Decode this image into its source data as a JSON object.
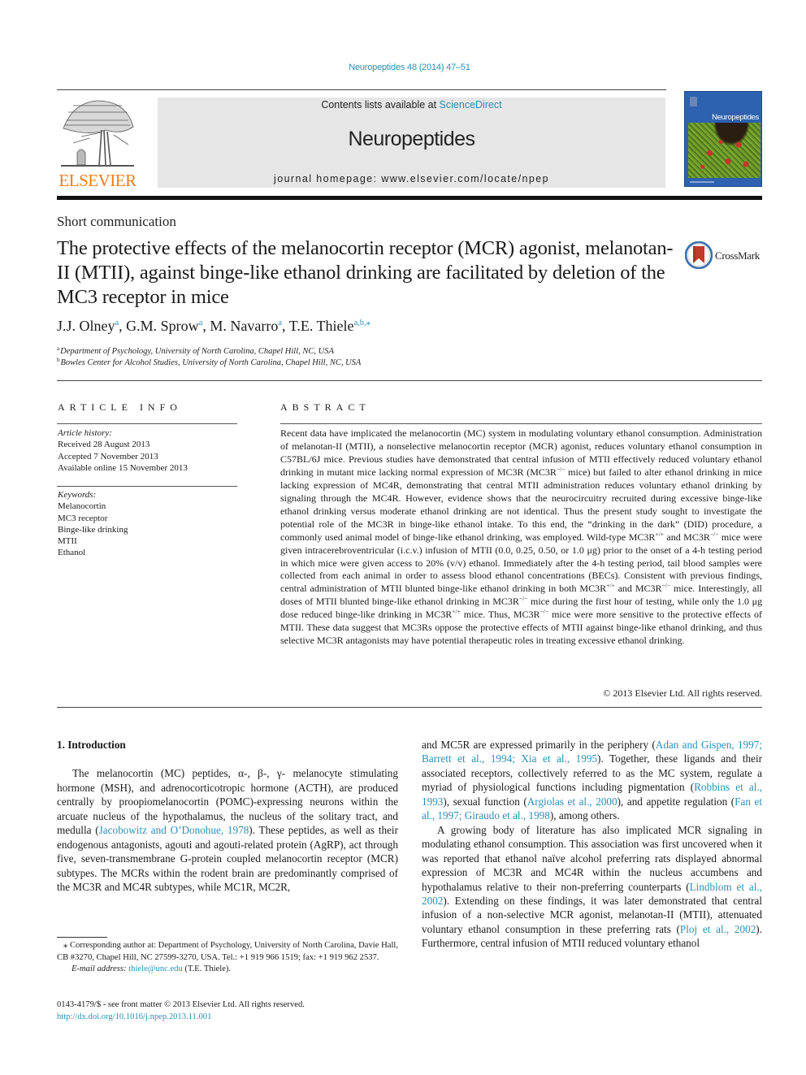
{
  "header": {
    "journal_reference": "Neuropeptides 48 (2014) 47–51",
    "publisher_name": "ELSEVIER",
    "contents_prefix": "Contents lists available at ",
    "contents_link": "ScienceDirect",
    "journal_name": "Neuropeptides",
    "homepage_prefix": "journal homepage: ",
    "homepage_url": "www.elsevier.com/locate/npep",
    "cover_title": "Neuropeptides",
    "publisher_color": "#f07d1b",
    "link_color": "#2a8fb8"
  },
  "article": {
    "type": "Short communication",
    "title": "The protective effects of the melanocortin receptor (MCR) agonist, melanotan-II (MTII), against binge-like ethanol drinking are facilitated by deletion of the MC3 receptor in mice",
    "crossmark_label": "CrossMark",
    "authors": [
      {
        "name": "J.J. Olney",
        "sup": "a"
      },
      {
        "name": "G.M. Sprow",
        "sup": "a"
      },
      {
        "name": "M. Navarro",
        "sup": "a"
      },
      {
        "name": "T.E. Thiele",
        "sup": "a,b,⁎"
      }
    ],
    "affiliations": [
      {
        "key": "a",
        "text": "Department of Psychology, University of North Carolina, Chapel Hill, NC, USA"
      },
      {
        "key": "b",
        "text": "Bowles Center for Alcohol Studies, University of North Carolina, Chapel Hill, NC, USA"
      }
    ]
  },
  "article_info": {
    "heading": "ARTICLE INFO",
    "history_label": "Article history:",
    "history": [
      "Received 28 August 2013",
      "Accepted 7 November 2013",
      "Available online 15 November 2013"
    ],
    "keywords_label": "Keywords:",
    "keywords": [
      "Melanocortin",
      "MC3 receptor",
      "Binge-like drinking",
      "MTII",
      "Ethanol"
    ]
  },
  "abstract": {
    "heading": "ABSTRACT",
    "segments": [
      "Recent data have implicated the melanocortin (MC) system in modulating voluntary ethanol consumption. Administration of melanotan-II (MTII), a nonselective melanocortin receptor (MCR) agonist, reduces voluntary ethanol consumption in C57BL/6J mice. Previous studies have demonstrated that central infusion of MTII effectively reduced voluntary ethanol drinking in mutant mice lacking normal expression of MC3R (MC3R",
      "−/−",
      " mice) but failed to alter ethanol drinking in mice lacking expression of MC4R, demonstrating that central MTII administration reduces voluntary ethanol drinking by signaling through the MC4R. However, evidence shows that the neurocircuitry recruited during excessive binge-like ethanol drinking versus moderate ethanol drinking are not identical. Thus the present study sought to investigate the potential role of the MC3R in binge-like ethanol intake. To this end, the “drinking in the dark” (DID) procedure, a commonly used animal model of binge-like ethanol drinking, was employed. Wild-type MC3R",
      "+/+",
      " and MC3R",
      "−/−",
      " mice were given intracerebroventricular (i.c.v.) infusion of MTII (0.0, 0.25, 0.50, or 1.0 μg) prior to the onset of a 4-h testing period in which mice were given access to 20% (v/v) ethanol. Immediately after the 4-h testing period, tail blood samples were collected from each animal in order to assess blood ethanol concentrations (BECs). Consistent with previous findings, central administration of MTII blunted binge-like ethanol drinking in both MC3R",
      "+/+",
      " and MC3R",
      "−/−",
      " mice. Interestingly, all doses of MTII blunted binge-like ethanol drinking in MC3R",
      "−/−",
      " mice during the first hour of testing, while only the 1.0 μg dose reduced binge-like drinking in MC3R",
      "+/+",
      " mice. Thus, MC3R",
      "−/−",
      " mice were more sensitive to the protective effects of MTII. These data suggest that MC3Rs oppose the protective effects of MTII against binge-like ethanol drinking, and thus selective MC3R antagonists may have potential therapeutic roles in treating excessive ethanol drinking."
    ],
    "copyright": "© 2013 Elsevier Ltd. All rights reserved."
  },
  "body": {
    "intro_heading": "1. Introduction",
    "left_p1": [
      {
        "t": "The melanocortin (MC) peptides, α-, β-, γ- melanocyte stimulating hormone (MSH), and adrenocorticotropic hormone (ACTH), are produced centrally by proopiomelanocortin (POMC)-expressing neurons within the arcuate nucleus of the hypothalamus, the nucleus of the solitary tract, and medulla ("
      },
      {
        "t": "Jacobowitz and O’Donohue, 1978",
        "link": true
      },
      {
        "t": "). These peptides, as well as their endogenous antagonists, agouti and agouti-related protein (AgRP), act through five, seven-transmembrane G-protein coupled melanocortin receptor (MCR) subtypes. The MCRs within the rodent brain are predominantly comprised of the MC3R and MC4R subtypes, while MC1R, MC2R,"
      }
    ],
    "right_p1": [
      {
        "t": "and MC5R are expressed primarily in the periphery ("
      },
      {
        "t": "Adan and Gispen, 1997; Barrett et al., 1994; Xia et al., 1995",
        "link": true
      },
      {
        "t": "). Together, these ligands and their associated receptors, collectively referred to as the MC system, regulate a myriad of physiological functions including pigmentation ("
      },
      {
        "t": "Robbins et al., 1993",
        "link": true
      },
      {
        "t": "), sexual function ("
      },
      {
        "t": "Argiolas et al., 2000",
        "link": true
      },
      {
        "t": "), and appetite regulation ("
      },
      {
        "t": "Fan et al., 1997; Giraudo et al., 1998",
        "link": true
      },
      {
        "t": "), among others."
      }
    ],
    "right_p2": [
      {
        "t": "A growing body of literature has also implicated MCR signaling in modulating ethanol consumption. This association was first uncovered when it was reported that ethanol naïve alcohol preferring rats displayed abnormal expression of MC3R and MC4R within the nucleus accumbens and hypothalamus relative to their non-preferring counterparts ("
      },
      {
        "t": "Lindblom et al., 2002",
        "link": true
      },
      {
        "t": "). Extending on these findings, it was later demonstrated that central infusion of a non-selective MCR agonist, melanotan-II (MTII), attenuated voluntary ethanol consumption in these preferring rats ("
      },
      {
        "t": "Ploj et al., 2002",
        "link": true
      },
      {
        "t": "). Furthermore, central infusion of MTII reduced voluntary ethanol"
      }
    ]
  },
  "footnote": {
    "corresponding": "⁎ Corresponding author at: Department of Psychology, University of North Carolina, Davie Hall, CB #3270, Chapel Hill, NC 27599-3270, USA. Tel.: +1 919 966 1519; fax: +1 919 962 2537.",
    "email_label": "E-mail address: ",
    "email": "thiele@unc.edu",
    "email_suffix": " (T.E. Thiele)."
  },
  "front_matter": {
    "issn_line": "0143-4179/$ - see front matter © 2013 Elsevier Ltd. All rights reserved.",
    "doi": "http://dx.doi.org/10.1016/j.npep.2013.11.001"
  }
}
